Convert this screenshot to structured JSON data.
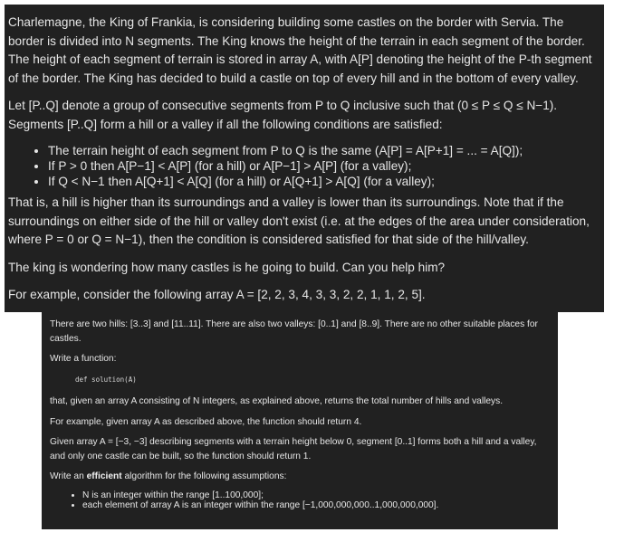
{
  "top": {
    "p1": "Charlemagne, the King of Frankia, is considering building some castles on the border with Servia. The border is divided into N segments. The King knows the height of the terrain in each segment of the border. The height of each segment of terrain is stored in array A, with A[P] denoting the height of the P-th segment of the border. The King has decided to build a castle on top of every hill and in the bottom of every valley.",
    "p2": "Let [P..Q] denote a group of consecutive segments from P to Q inclusive such that (0 ≤ P ≤ Q ≤ N−1). Segments [P..Q] form a hill or a valley if all the following conditions are satisfied:",
    "bullets": [
      "The terrain height of each segment from P to Q is the same (A[P] = A[P+1] = ... = A[Q]);",
      "If P > 0 then A[P−1] < A[P] (for a hill) or A[P−1] > A[P] (for a valley);",
      "If Q < N−1 then A[Q+1] < A[Q] (for a hill) or A[Q+1] > A[Q] (for a valley);"
    ],
    "p3": "That is, a hill is higher than its surroundings and a valley is lower than its surroundings. Note that if the surroundings on either side of the hill or valley don't exist (i.e. at the edges of the area under consideration, where P = 0 or Q = N−1), then the condition is considered satisfied for that side of the hill/valley.",
    "p4": "The king is wondering how many castles is he going to build. Can you help him?",
    "p5": "For example, consider the following array A = [2, 2, 3, 4, 3, 3, 2, 2, 1, 1, 2, 5]."
  },
  "bottom": {
    "p1": "There are two hills: [3..3] and [11..11]. There are also two valleys: [0..1] and [8..9]. There are no other suitable places for castles.",
    "p2": "Write a function:",
    "code": "def solution(A)",
    "p3": "that, given an array A consisting of N integers, as explained above, returns the total number of hills and valleys.",
    "p4": "For example, given array A as described above, the function should return 4.",
    "p5": "Given array A = [−3, −3] describing segments with a terrain height below 0, segment [0..1] forms both a hill and a valley, and only one castle can be built, so the function should return 1.",
    "p6_prefix": "Write an ",
    "p6_bold": "efficient",
    "p6_suffix": " algorithm for the following assumptions:",
    "bullets": [
      "N is an integer within the range [1..100,000];",
      "each element of array A is an integer within the range [−1,000,000,000..1,000,000,000]."
    ]
  },
  "colors": {
    "panel_bg": "#212121",
    "text": "#e6e6e6",
    "page_bg": "#ffffff"
  }
}
